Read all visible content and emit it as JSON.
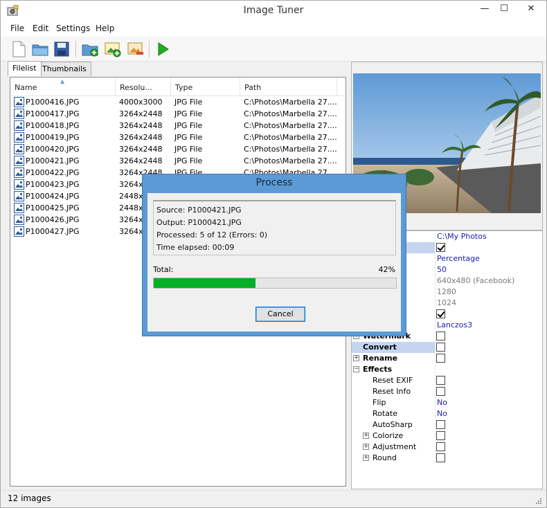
{
  "window": {
    "title": "Image Tuner",
    "min": "—",
    "max": "☐",
    "close": "✕"
  },
  "menu": [
    "File",
    "Edit",
    "Settings",
    "Help"
  ],
  "tabs": [
    "Filelist",
    "Thumbnails"
  ],
  "filelist": {
    "columns": [
      "Name",
      "Resolu...",
      "Type",
      "Path"
    ],
    "rows": [
      {
        "name": "P1000416.JPG",
        "res": "4000x3000",
        "type": "JPG File",
        "path": "C:\\Photos\\Marbella 27...."
      },
      {
        "name": "P1000417.JPG",
        "res": "3264x2448",
        "type": "JPG File",
        "path": "C:\\Photos\\Marbella 27...."
      },
      {
        "name": "P1000418.JPG",
        "res": "3264x2448",
        "type": "JPG File",
        "path": "C:\\Photos\\Marbella 27...."
      },
      {
        "name": "P1000419.JPG",
        "res": "3264x2448",
        "type": "JPG File",
        "path": "C:\\Photos\\Marbella 27...."
      },
      {
        "name": "P1000420.JPG",
        "res": "3264x2448",
        "type": "JPG File",
        "path": "C:\\Photos\\Marbella 27...."
      },
      {
        "name": "P1000421.JPG",
        "res": "3264x2448",
        "type": "JPG File",
        "path": "C:\\Photos\\Marbella 27...."
      },
      {
        "name": "P1000422.JPG",
        "res": "3264x2448",
        "type": "JPG File",
        "path": "C:\\Photos\\Marbella 27"
      },
      {
        "name": "P1000423.JPG",
        "res": "3264x",
        "type": "",
        "path": ""
      },
      {
        "name": "P1000424.JPG",
        "res": "2448x",
        "type": "",
        "path": ""
      },
      {
        "name": "P1000425.JPG",
        "res": "2448x",
        "type": "",
        "path": ""
      },
      {
        "name": "P1000426.JPG",
        "res": "3264x",
        "type": "",
        "path": ""
      },
      {
        "name": "P1000427.JPG",
        "res": "3264x2",
        "type": "",
        "path": ""
      }
    ]
  },
  "properties": [
    {
      "name": "",
      "value": "C:\\My Photos",
      "kind": "link"
    },
    {
      "name": "",
      "value": "",
      "kind": "check",
      "checked": true,
      "sel": true
    },
    {
      "name": "",
      "value": "Percentage",
      "kind": "link"
    },
    {
      "name": "e (%)",
      "value": "50",
      "kind": "link"
    },
    {
      "name": "e",
      "value": "640x480 (Facebook)",
      "kind": "dim"
    },
    {
      "name": "dth",
      "value": "1280",
      "kind": "dim"
    },
    {
      "name": "eight",
      "value": "1024",
      "kind": "dim"
    },
    {
      "name": "ortions",
      "value": "",
      "kind": "check",
      "checked": true
    },
    {
      "name": "",
      "value": "Lanczos3",
      "kind": "link"
    },
    {
      "name": "Watermark",
      "value": "",
      "kind": "check",
      "checked": false,
      "bold": true,
      "exp": "+"
    },
    {
      "name": "Convert",
      "value": "",
      "kind": "check",
      "checked": false,
      "bold": true,
      "exp": "+",
      "sel": true
    },
    {
      "name": "Rename",
      "value": "",
      "kind": "check",
      "checked": false,
      "bold": true,
      "exp": "+"
    },
    {
      "name": "Effects",
      "value": "",
      "kind": "none",
      "bold": true,
      "exp": "−"
    },
    {
      "name": "Reset EXIF",
      "value": "",
      "kind": "check",
      "checked": false,
      "indent": 1
    },
    {
      "name": "Reset Info",
      "value": "",
      "kind": "check",
      "checked": false,
      "indent": 1
    },
    {
      "name": "Flip",
      "value": "No",
      "kind": "link",
      "indent": 1
    },
    {
      "name": "Rotate",
      "value": "No",
      "kind": "link",
      "indent": 1
    },
    {
      "name": "AutoSharp",
      "value": "",
      "kind": "check",
      "checked": false,
      "indent": 1
    },
    {
      "name": "Colorize",
      "value": "",
      "kind": "check",
      "checked": false,
      "indent": 1,
      "exp": "+"
    },
    {
      "name": "Adjustment",
      "value": "",
      "kind": "check",
      "checked": false,
      "indent": 1,
      "exp": "+"
    },
    {
      "name": "Round",
      "value": "",
      "kind": "check",
      "checked": false,
      "indent": 1,
      "exp": "+"
    }
  ],
  "status": {
    "text": "12 images"
  },
  "dialog": {
    "title": "Process",
    "source": "Source: P1000421.JPG",
    "output": "Output: P1000421.JPG",
    "processed": "Processed: 5 of 12 (Errors: 0)",
    "elapsed": "Time elapsed: 00:09",
    "total_label": "Total:",
    "total_pct": "42%",
    "progress": 0.42,
    "cancel_label": "Cancel"
  },
  "colors": {
    "accent": "#0078d7",
    "progress": "#06b025",
    "link": "#1a1ab4",
    "dialog_frame": "#5b9ad5"
  },
  "icons": [
    "app-icon",
    "new-file-icon",
    "open-folder-icon",
    "save-icon",
    "add-folder-icon",
    "add-image-icon",
    "remove-image-icon",
    "play-icon",
    "image-file-icon",
    "resize-grip-icon"
  ]
}
